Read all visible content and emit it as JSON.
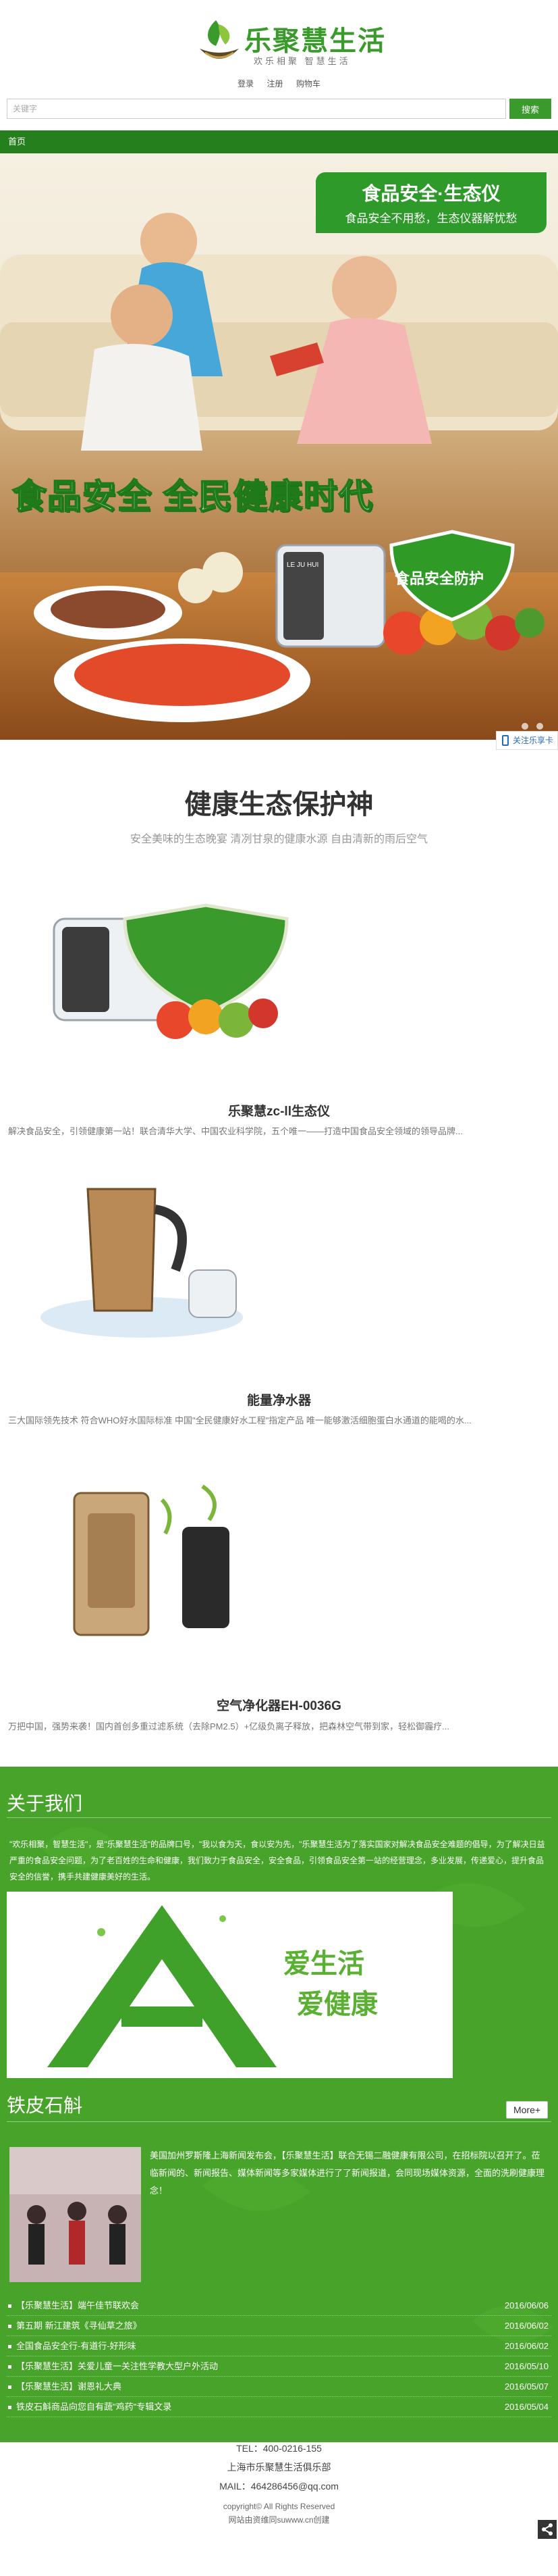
{
  "brand": {
    "logo_text": "乐聚慧生活",
    "tagline": "欢乐相聚 智慧生活"
  },
  "top_links": [
    "登录",
    "注册",
    "购物车"
  ],
  "search": {
    "placeholder": "关键字",
    "button": "搜索"
  },
  "nav": {
    "home": "首页"
  },
  "banner": {
    "tag_title": "食品安全·生态仪",
    "tag_sub": "食品安全不用愁，生态仪器解忧愁",
    "slogan": "食品安全 全民健康时代",
    "shield_text": "食品安全防护",
    "device_label": "LE JU HUI"
  },
  "side_follow": "关注乐享卡",
  "products_section": {
    "title": "健康生态保护神",
    "subtitle": "安全美味的生态晚宴  清冽甘泉的健康水源  自由清新的雨后空气"
  },
  "products": [
    {
      "name": "乐聚慧zc-ll生态仪",
      "desc": "解决食品安全，引领健康第一站！联合清华大学、中国农业科学院，五个唯一——打造中国食品安全领域的领导品牌..."
    },
    {
      "name": "能量净水器",
      "desc": "三大国际领先技术 符合WHO好水国际标准    中国\"全民健康好水工程\"指定产品    唯一能够激活细胞蛋白水通道的能喝的水..."
    },
    {
      "name": "空气净化器EH-0036G",
      "desc": "万把中国，强势来袭！国内首创多重过滤系统（去除PM2.5）+亿级负离子释放，把森林空气带到家，轻松御霾疗..."
    }
  ],
  "about": {
    "title": "关于我们",
    "text": "\"欢乐相聚，智慧生活\"，是\"乐聚慧生活\"的品牌口号，\"我以食为天，食以安为先，\"乐聚慧生活为了落实国家对解决食品安全难题的倡导，为了解决日益严重的食品安全问题，为了老百姓的生命和健康，我们致力于食品安全，安全食品，引领食品安全第一站的经营理念，多业发展，传递爱心，提升食品安全的信誉，携手共建健康美好的生活。",
    "image_text_1": "爱生活",
    "image_text_2": "爱健康"
  },
  "news": {
    "title": "铁皮石斛",
    "more": "More+",
    "lead": "美国加州罗斯隆上海新闻发布会，【乐聚慧生活】联合无锡二融健康有限公司，在招标院以召开了。莅临新闻的、新闻报告、媒体新闻等多家媒体进行了了新闻报道，会同现场媒体资源，全面的洗刷健康理念！",
    "items": [
      {
        "title": "【乐聚慧生活】端午佳节联欢会",
        "date": "2016/06/06"
      },
      {
        "title": "第五期 新江建筑《寻仙草之旅》",
        "date": "2016/06/02"
      },
      {
        "title": "全国食品安全行-有道行-好形味",
        "date": "2016/06/02"
      },
      {
        "title": "【乐聚慧生活】关爱儿童一关注性学教大型户外活动",
        "date": "2016/05/10"
      },
      {
        "title": "【乐聚慧生活】谢恩礼大典",
        "date": "2016/05/07"
      },
      {
        "title": "铁皮石斛商品向您自有蔬\"鸡药\"专辑文录",
        "date": "2016/05/04"
      }
    ]
  },
  "footer": {
    "tel": "TEL：400-0216-155",
    "org": "上海市乐聚慧生活俱乐部",
    "mail": "MAIL：464286456@qq.com",
    "copyright": "copyright© All Rights Reserved",
    "credit": "网站由资维同suwww.cn创建"
  },
  "colors": {
    "brand_green": "#3a9a2c",
    "nav_green": "#2f9a25",
    "section_green": "#47a329"
  }
}
